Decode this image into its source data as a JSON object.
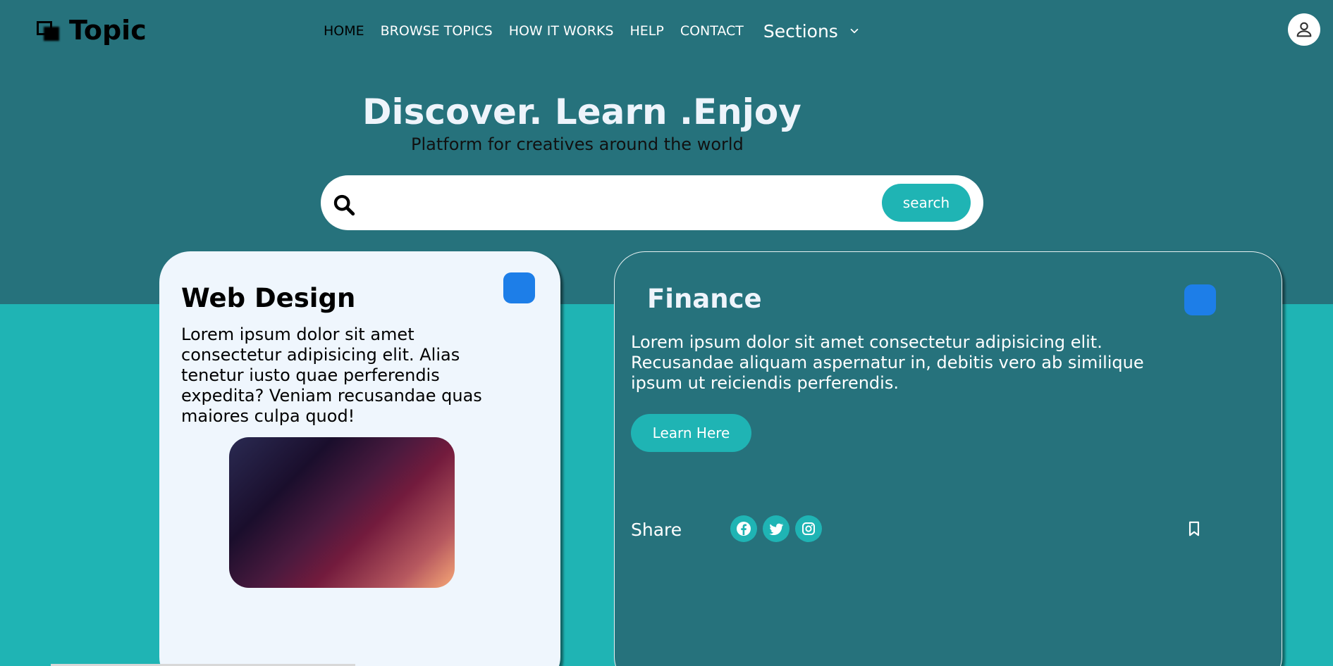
{
  "header": {
    "logo_text": "Topic",
    "nav": {
      "home": "HOME",
      "browse": "BROWSE TOPICS",
      "how": "HOW IT WORKS",
      "help": "HELP",
      "contact": "CONTACT",
      "sections": "Sections"
    },
    "icons": [
      "logo-icon",
      "chevron-down-icon",
      "user-icon"
    ]
  },
  "hero": {
    "title": "Discover. Learn .Enjoy",
    "subtitle": "Platform for creatives around the world"
  },
  "search": {
    "placeholder": "",
    "button_label": "search",
    "icon": "search-icon"
  },
  "cards": {
    "web": {
      "title": "Web Design",
      "text": "Lorem ipsum dolor sit amet consectetur adipisicing elit. Alias tenetur iusto quae perferendis expedita? Veniam recusandae quas maiores culpa quod!",
      "badge_color": "#1d7ee8"
    },
    "finance": {
      "title": "Finance",
      "text": "Lorem ipsum dolor sit amet consectetur adipisicing elit. Recusandae aliquam aspernatur in, debitis vero ab similique ipsum ut reiciendis perferendis.",
      "button_label": "Learn Here",
      "share_label": "Share",
      "social_icons": [
        "facebook-icon",
        "twitter-icon",
        "instagram-icon"
      ],
      "bookmark_icon": "bookmark-icon",
      "badge_color": "#1d7ee8"
    }
  },
  "colors": {
    "header_bg": "#26727c",
    "accent": "#1fb4b4",
    "card_light": "#eff6fd"
  }
}
